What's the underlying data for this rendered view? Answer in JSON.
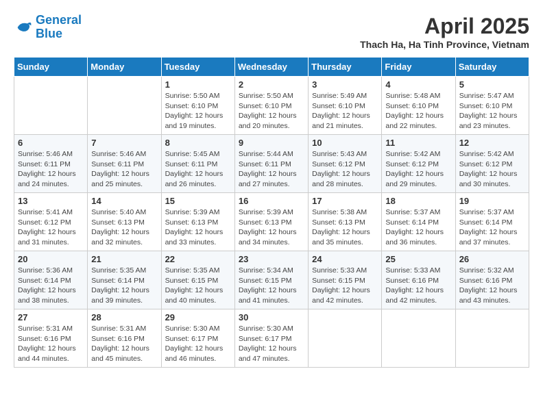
{
  "logo": {
    "line1": "General",
    "line2": "Blue"
  },
  "title": "April 2025",
  "subtitle": "Thach Ha, Ha Tinh Province, Vietnam",
  "days_of_week": [
    "Sunday",
    "Monday",
    "Tuesday",
    "Wednesday",
    "Thursday",
    "Friday",
    "Saturday"
  ],
  "weeks": [
    [
      {
        "day": "",
        "info": ""
      },
      {
        "day": "",
        "info": ""
      },
      {
        "day": "1",
        "info": "Sunrise: 5:50 AM\nSunset: 6:10 PM\nDaylight: 12 hours and 19 minutes."
      },
      {
        "day": "2",
        "info": "Sunrise: 5:50 AM\nSunset: 6:10 PM\nDaylight: 12 hours and 20 minutes."
      },
      {
        "day": "3",
        "info": "Sunrise: 5:49 AM\nSunset: 6:10 PM\nDaylight: 12 hours and 21 minutes."
      },
      {
        "day": "4",
        "info": "Sunrise: 5:48 AM\nSunset: 6:10 PM\nDaylight: 12 hours and 22 minutes."
      },
      {
        "day": "5",
        "info": "Sunrise: 5:47 AM\nSunset: 6:10 PM\nDaylight: 12 hours and 23 minutes."
      }
    ],
    [
      {
        "day": "6",
        "info": "Sunrise: 5:46 AM\nSunset: 6:11 PM\nDaylight: 12 hours and 24 minutes."
      },
      {
        "day": "7",
        "info": "Sunrise: 5:46 AM\nSunset: 6:11 PM\nDaylight: 12 hours and 25 minutes."
      },
      {
        "day": "8",
        "info": "Sunrise: 5:45 AM\nSunset: 6:11 PM\nDaylight: 12 hours and 26 minutes."
      },
      {
        "day": "9",
        "info": "Sunrise: 5:44 AM\nSunset: 6:11 PM\nDaylight: 12 hours and 27 minutes."
      },
      {
        "day": "10",
        "info": "Sunrise: 5:43 AM\nSunset: 6:12 PM\nDaylight: 12 hours and 28 minutes."
      },
      {
        "day": "11",
        "info": "Sunrise: 5:42 AM\nSunset: 6:12 PM\nDaylight: 12 hours and 29 minutes."
      },
      {
        "day": "12",
        "info": "Sunrise: 5:42 AM\nSunset: 6:12 PM\nDaylight: 12 hours and 30 minutes."
      }
    ],
    [
      {
        "day": "13",
        "info": "Sunrise: 5:41 AM\nSunset: 6:12 PM\nDaylight: 12 hours and 31 minutes."
      },
      {
        "day": "14",
        "info": "Sunrise: 5:40 AM\nSunset: 6:13 PM\nDaylight: 12 hours and 32 minutes."
      },
      {
        "day": "15",
        "info": "Sunrise: 5:39 AM\nSunset: 6:13 PM\nDaylight: 12 hours and 33 minutes."
      },
      {
        "day": "16",
        "info": "Sunrise: 5:39 AM\nSunset: 6:13 PM\nDaylight: 12 hours and 34 minutes."
      },
      {
        "day": "17",
        "info": "Sunrise: 5:38 AM\nSunset: 6:13 PM\nDaylight: 12 hours and 35 minutes."
      },
      {
        "day": "18",
        "info": "Sunrise: 5:37 AM\nSunset: 6:14 PM\nDaylight: 12 hours and 36 minutes."
      },
      {
        "day": "19",
        "info": "Sunrise: 5:37 AM\nSunset: 6:14 PM\nDaylight: 12 hours and 37 minutes."
      }
    ],
    [
      {
        "day": "20",
        "info": "Sunrise: 5:36 AM\nSunset: 6:14 PM\nDaylight: 12 hours and 38 minutes."
      },
      {
        "day": "21",
        "info": "Sunrise: 5:35 AM\nSunset: 6:14 PM\nDaylight: 12 hours and 39 minutes."
      },
      {
        "day": "22",
        "info": "Sunrise: 5:35 AM\nSunset: 6:15 PM\nDaylight: 12 hours and 40 minutes."
      },
      {
        "day": "23",
        "info": "Sunrise: 5:34 AM\nSunset: 6:15 PM\nDaylight: 12 hours and 41 minutes."
      },
      {
        "day": "24",
        "info": "Sunrise: 5:33 AM\nSunset: 6:15 PM\nDaylight: 12 hours and 42 minutes."
      },
      {
        "day": "25",
        "info": "Sunrise: 5:33 AM\nSunset: 6:16 PM\nDaylight: 12 hours and 42 minutes."
      },
      {
        "day": "26",
        "info": "Sunrise: 5:32 AM\nSunset: 6:16 PM\nDaylight: 12 hours and 43 minutes."
      }
    ],
    [
      {
        "day": "27",
        "info": "Sunrise: 5:31 AM\nSunset: 6:16 PM\nDaylight: 12 hours and 44 minutes."
      },
      {
        "day": "28",
        "info": "Sunrise: 5:31 AM\nSunset: 6:16 PM\nDaylight: 12 hours and 45 minutes."
      },
      {
        "day": "29",
        "info": "Sunrise: 5:30 AM\nSunset: 6:17 PM\nDaylight: 12 hours and 46 minutes."
      },
      {
        "day": "30",
        "info": "Sunrise: 5:30 AM\nSunset: 6:17 PM\nDaylight: 12 hours and 47 minutes."
      },
      {
        "day": "",
        "info": ""
      },
      {
        "day": "",
        "info": ""
      },
      {
        "day": "",
        "info": ""
      }
    ]
  ]
}
